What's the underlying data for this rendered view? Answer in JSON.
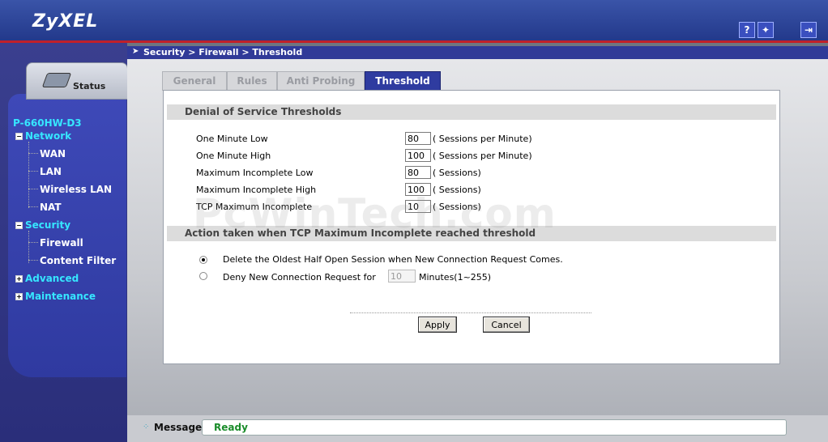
{
  "header": {
    "logo": "ZyXEL",
    "help_icon": "?",
    "wizard_icon": "✦",
    "logout_icon": "⇥"
  },
  "status_tab": {
    "label": "Status"
  },
  "sidebar": {
    "model": "P-660HW-D3",
    "items": [
      {
        "label": "Network",
        "type": "category",
        "toggle": "−"
      },
      {
        "label": "WAN",
        "type": "child"
      },
      {
        "label": "LAN",
        "type": "child"
      },
      {
        "label": "Wireless LAN",
        "type": "child"
      },
      {
        "label": "NAT",
        "type": "child"
      },
      {
        "label": "Security",
        "type": "category",
        "toggle": "−"
      },
      {
        "label": "Firewall",
        "type": "child"
      },
      {
        "label": "Content Filter",
        "type": "child"
      },
      {
        "label": "Advanced",
        "type": "category",
        "toggle": "+"
      },
      {
        "label": "Maintenance",
        "type": "category",
        "toggle": "+"
      }
    ]
  },
  "breadcrumb": "Security > Firewall > Threshold",
  "tabs": [
    {
      "label": "General",
      "active": false
    },
    {
      "label": "Rules",
      "active": false
    },
    {
      "label": "Anti Probing",
      "active": false
    },
    {
      "label": "Threshold",
      "active": true
    }
  ],
  "dos": {
    "title": "Denial of Service Thresholds",
    "rows": [
      {
        "label": "One Minute Low",
        "value": "80",
        "unit": "( Sessions per Minute)"
      },
      {
        "label": "One Minute High",
        "value": "100",
        "unit": "( Sessions per Minute)"
      },
      {
        "label": "Maximum Incomplete Low",
        "value": "80",
        "unit": "( Sessions)"
      },
      {
        "label": "Maximum Incomplete High",
        "value": "100",
        "unit": "( Sessions)"
      },
      {
        "label": "TCP Maximum Incomplete",
        "value": "10",
        "unit": "( Sessions)"
      }
    ]
  },
  "action": {
    "title": "Action taken when TCP Maximum Incomplete reached threshold",
    "option1": "Delete the Oldest Half Open Session when New Connection Request Comes.",
    "option2": "Deny New Connection Request for",
    "minutes_value": "10",
    "minutes_unit": "Minutes(1~255)",
    "selected": 1
  },
  "buttons": {
    "apply": "Apply",
    "cancel": "Cancel"
  },
  "message": {
    "label": "Message",
    "status": "Ready"
  },
  "watermark": "PcWinTech.com"
}
